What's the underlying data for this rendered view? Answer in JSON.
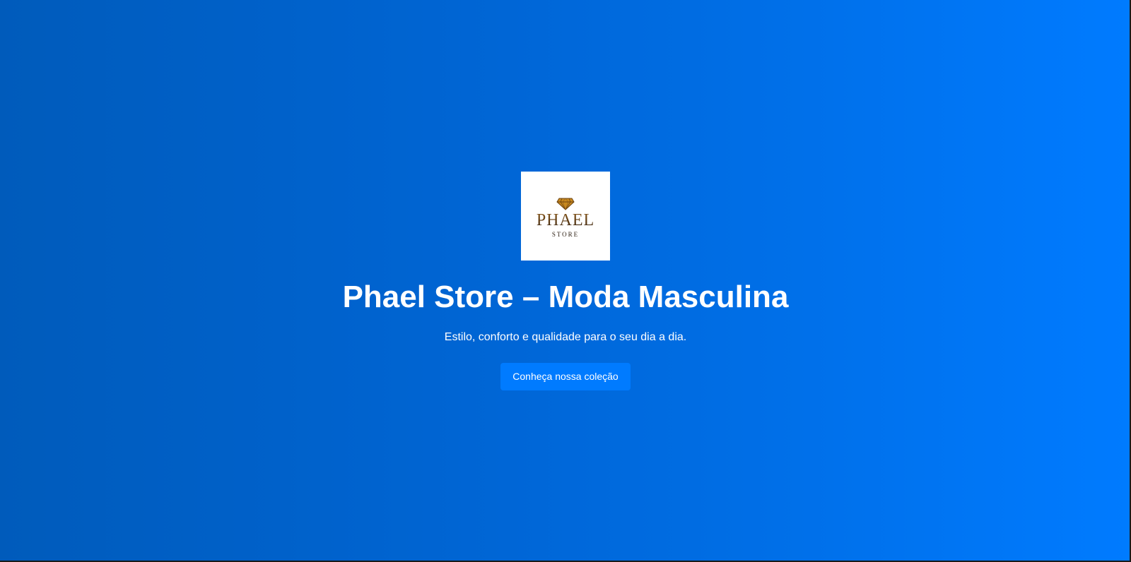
{
  "brand": {
    "logo_word": "PHAEL",
    "logo_sub": "STORE",
    "logo_icon": "diamond-icon"
  },
  "hero": {
    "title": "Phael Store – Moda Masculina",
    "subtitle": "Estilo, conforto e qualidade para o seu dia a dia.",
    "cta_label": "Conheça nossa coleção"
  },
  "colors": {
    "gradient_start": "#005bbb",
    "gradient_end": "#007bff",
    "button": "#007bff",
    "text": "#ffffff",
    "logo_gold": "#c8891f"
  }
}
